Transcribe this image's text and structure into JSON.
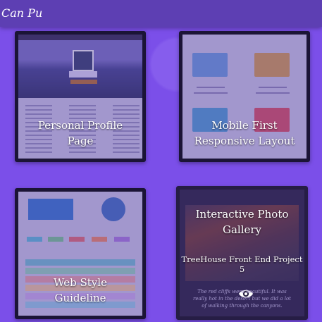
{
  "header": {
    "brand": "Can Pu"
  },
  "projects": [
    {
      "label_line1": "Personal Profile",
      "label_line2": "Page"
    },
    {
      "label_line1": "Mobile First",
      "label_line2": "Responsive Layout"
    },
    {
      "label_line1": "Web Style",
      "label_line2": "Guideline"
    },
    {
      "label_line1": "Interactive Photo",
      "label_line2": "Gallery",
      "subtitle": "TreeHouse Front End Project 5",
      "caption": "The red cliffs were beautiful. It was really hot in the desert but we did a lot of walking through the canyons."
    }
  ],
  "colors": {
    "background": "#7b4fe9",
    "header": "#5d3fb3",
    "card_border": "#1b1436"
  },
  "icons": {
    "view": "eye-icon"
  }
}
